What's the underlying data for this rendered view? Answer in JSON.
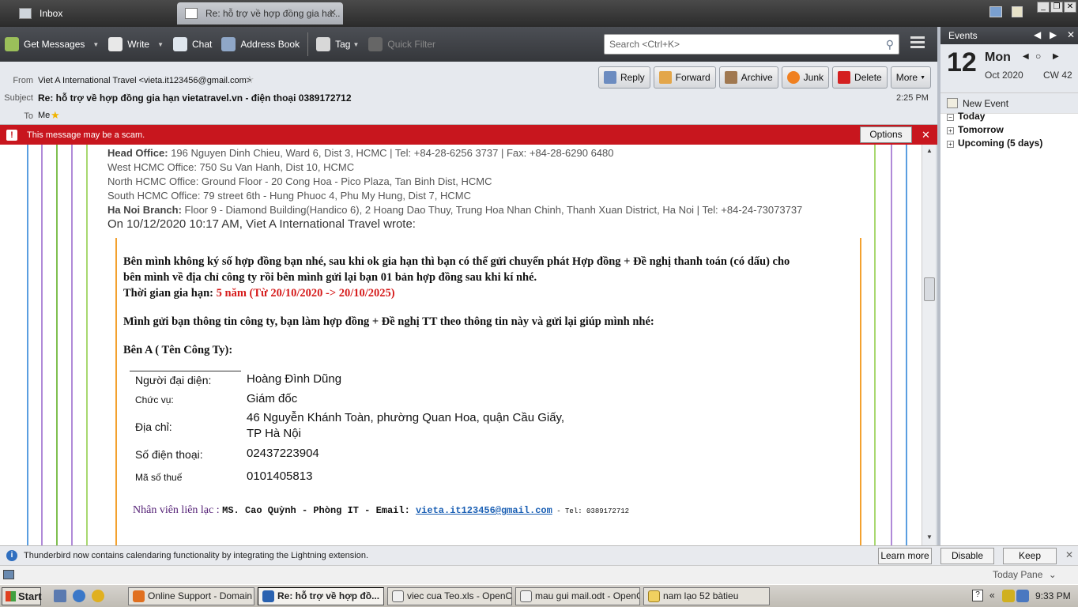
{
  "tabs": {
    "inbox": "Inbox",
    "message": "Re: hỗ trợ về hợp đồng gia ha..."
  },
  "toolbar": {
    "get_messages": "Get Messages",
    "write": "Write",
    "chat": "Chat",
    "address_book": "Address Book",
    "tag": "Tag",
    "quick_filter": "Quick Filter",
    "search_placeholder": "Search <Ctrl+K>"
  },
  "header": {
    "from_label": "From",
    "from_value": "Viet A International Travel <vieta.it123456@gmail.com>",
    "subject_label": "Subject",
    "subject_value": "Re: hỗ trợ về hợp đồng gia hạn vietatravel.vn - điện thoại 0389172712",
    "to_label": "To",
    "to_value": "Me",
    "time": "2:25 PM",
    "actions": {
      "reply": "Reply",
      "forward": "Forward",
      "archive": "Archive",
      "junk": "Junk",
      "delete": "Delete",
      "more": "More"
    }
  },
  "scam": {
    "text": "This message may be a scam.",
    "options": "Options"
  },
  "signature": {
    "head_label": "Head Office:",
    "head_text": " 196 Nguyen Dinh Chieu, Ward 6, Dist 3, HCMC | Tel: +84-28-6256 3737 | Fax: +84-28-6290 6480",
    "west": "West HCMC Office: 750 Su Van Hanh, Dist 10, HCMC",
    "north": "North HCMC Office: Ground Floor - 20 Cong Hoa - Pico Plaza, Tan Binh Dist, HCMC",
    "south": "South HCMC Office: 79 street 6th - Hung Phuoc 4, Phu My Hung, Dist 7, HCMC",
    "hanoi_label": "Ha Noi Branch:",
    "hanoi_text": " Floor 9 - Diamond Building(Handico 6), 2 Hoang Dao Thuy, Trung Hoa Nhan Chinh, Thanh Xuan District, Ha Noi | Tel: +84-24-73073737"
  },
  "quote": {
    "intro": "On 10/12/2020 10:17 AM, Viet A International Travel wrote:",
    "p1_line1": "Bên mình không ký số hợp đồng bạn nhé, sau khi ok gia hạn thì bạn có thể gửi chuyển phát Hợp đồng  + Đề nghị thanh toán (có dấu) cho",
    "p1_line2": "bên mình về địa chỉ công ty rồi bên mình gửi lại bạn 01 bản hợp đồng sau khi kí nhé.",
    "term_label": "Thời gian gia hạn: ",
    "term_value": "5 năm (Từ 20/10/2020 -> 20/10/2025)",
    "p2": "Mình gửi bạn thông tin công ty, bạn làm hợp đồng + Đề nghị TT theo thông tin này và gửi lại giúp mình nhé:",
    "party": "Bên A ( Tên Công Ty):"
  },
  "company": {
    "rep_label": "Người đại diện:",
    "rep_value": "Hoàng Đình Dũng",
    "title_label": "Chức vụ:",
    "title_value": "Giám đốc",
    "addr_label": "Địa chỉ:",
    "addr_line1": "46 Nguyễn Khánh Toàn, phường Quan Hoa, quận Cầu Giấy,",
    "addr_line2": "TP Hà Nội",
    "phone_label": "Số điện thoại:",
    "phone_value": "02437223904",
    "tax_label": "Mã số thuế",
    "tax_value": "0101405813"
  },
  "contact": {
    "label": "Nhân viên liên lạc : ",
    "name": "MS. Cao Quỳnh - Phòng IT - Email: ",
    "email": "vieta.it123456@gmail.com",
    "tel": " - Tel:  0389172712"
  },
  "notify": {
    "text": "Thunderbird now contains calendaring functionality by integrating the Lightning extension.",
    "learn_more": "Learn more",
    "disable": "Disable",
    "keep": "Keep"
  },
  "status": {
    "today_pane": "Today Pane"
  },
  "events": {
    "title": "Events",
    "day": "12",
    "dow": "Mon",
    "month": "Oct 2020",
    "cw": "CW 42",
    "new_event": "New Event",
    "today": "Today",
    "tomorrow": "Tomorrow",
    "upcoming": "Upcoming (5 days)"
  },
  "taskbar": {
    "start": "Start",
    "tasks": [
      "Online Support - Domain |...",
      "Re: hỗ trợ về hợp đồ...",
      "viec cua Teo.xls - OpenO...",
      "mau gui mail.odt - OpenOf...",
      "nam lạo 52 bàtieu"
    ],
    "clock": "9:33 PM"
  },
  "colors": {
    "scam_bar": "#c8161e",
    "quote_border": "#f3a12f",
    "term_red": "#d61c1c",
    "link": "#1a5fb4"
  }
}
